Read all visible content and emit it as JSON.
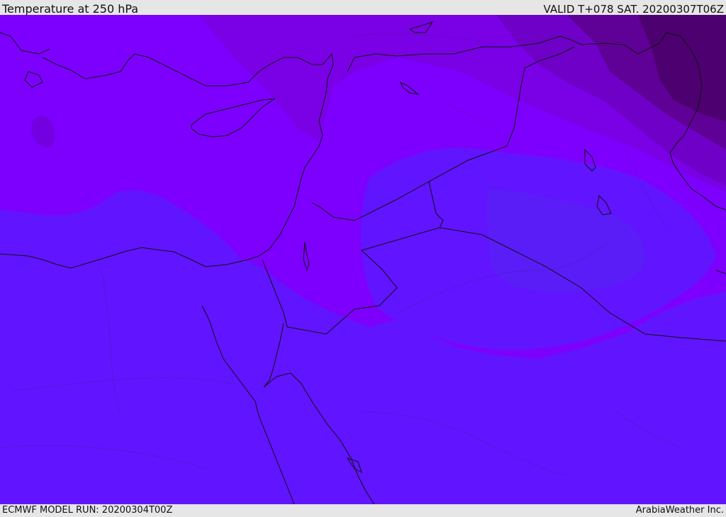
{
  "header": {
    "title": "Temperature at 250 hPa",
    "valid": "VALID T+078 SAT. 20200307T06Z"
  },
  "footer": {
    "model_run": "ECMWF MODEL RUN: 20200304T00Z",
    "brand": "ArabiaWeather Inc."
  },
  "colors": {
    "base": "#7d00ff",
    "band_cool": "#6114ff",
    "band_cooler": "#5a1cf7",
    "band_warm1": "#7a00e6",
    "band_warm2": "#6e00c8",
    "band_warm3": "#5f0096",
    "band_warm4": "#4d0070",
    "coastline": "#111111"
  }
}
